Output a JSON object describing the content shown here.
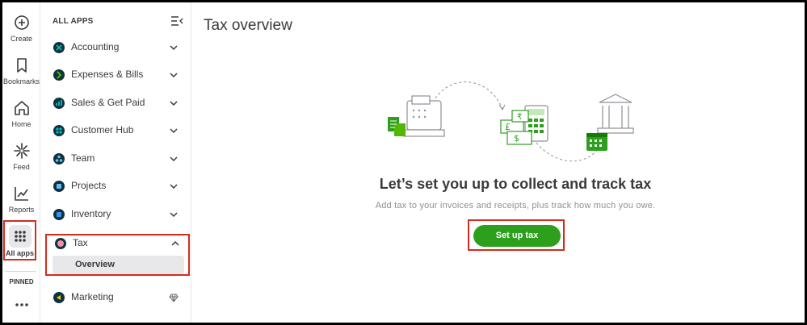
{
  "rail": {
    "create_label": "Create",
    "bookmarks_label": "Bookmarks",
    "home_label": "Home",
    "feed_label": "Feed",
    "reports_label": "Reports",
    "allapps_label": "All apps",
    "pinned_label": "PINNED"
  },
  "nav": {
    "heading": "ALL APPS",
    "items": [
      {
        "label": "Accounting",
        "icon": "accounting-icon",
        "color": "#0d333f"
      },
      {
        "label": "Expenses & Bills",
        "icon": "expenses-icon",
        "color": "#0d333f"
      },
      {
        "label": "Sales & Get Paid",
        "icon": "sales-icon",
        "color": "#0d333f"
      },
      {
        "label": "Customer Hub",
        "icon": "customer-hub-icon",
        "color": "#0d333f"
      },
      {
        "label": "Team",
        "icon": "team-icon",
        "color": "#0d333f"
      },
      {
        "label": "Projects",
        "icon": "projects-icon",
        "color": "#0d333f"
      },
      {
        "label": "Inventory",
        "icon": "inventory-icon",
        "color": "#0d333f"
      },
      {
        "label": "Tax",
        "icon": "tax-icon",
        "color": "#0d333f"
      },
      {
        "label": "Marketing",
        "icon": "marketing-icon",
        "color": "#0d333f"
      }
    ],
    "tax_sub": "Overview"
  },
  "main": {
    "title": "Tax overview",
    "headline": "Let’s set you up to collect and track tax",
    "subline": "Add tax to your invoices and receipts, plus track how much you owe.",
    "cta": "Set up tax"
  },
  "colors": {
    "brand_green": "#2ca01c",
    "highlight_red": "#d52b1e",
    "text_dark": "#393a3d"
  }
}
